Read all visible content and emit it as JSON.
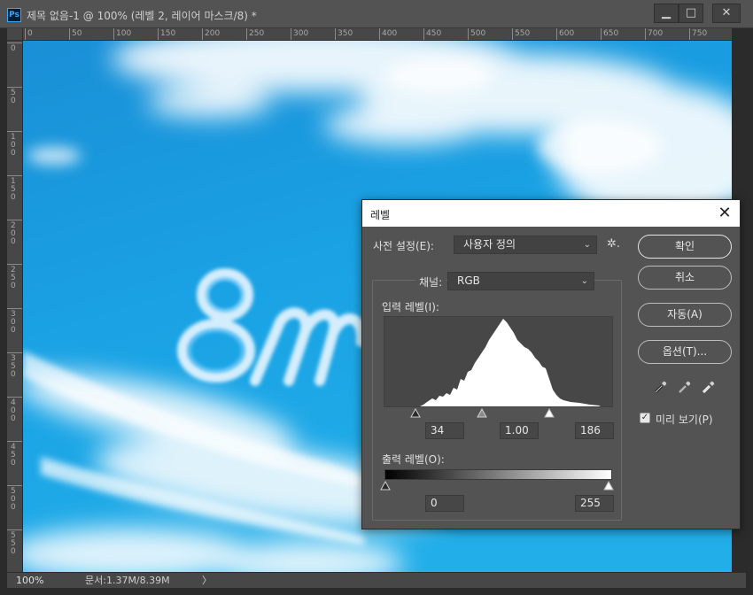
{
  "window": {
    "app_badge": "Ps",
    "title": "제목 없음-1 @ 100% (레벨 2, 레이어 마스크/8) *",
    "minimize": "▁",
    "restore": "□",
    "close": "✕"
  },
  "ruler_h_labels": [
    "0",
    "50",
    "100",
    "150",
    "200",
    "250",
    "300",
    "350",
    "400",
    "450",
    "500",
    "550",
    "600",
    "650",
    "700",
    "750"
  ],
  "ruler_v_labels": [
    "0",
    "50",
    "100",
    "150",
    "200",
    "250",
    "300",
    "350",
    "400",
    "450",
    "500",
    "550"
  ],
  "canvas_text": "8m",
  "status": {
    "zoom": "100%",
    "doc_info": "문서:1.37M/8.39M",
    "arrow": "〉"
  },
  "dialog": {
    "title": "레벨",
    "close": "✕",
    "preset_label": "사전 설정(E):",
    "preset_value": "사용자 정의",
    "gear": "✲.",
    "channel_label": "채널:",
    "channel_value": "RGB",
    "input_levels_label": "입력 레벨(I):",
    "input_black": "34",
    "input_gamma": "1.00",
    "input_white": "186",
    "output_levels_label": "출력 레벨(O):",
    "output_black": "0",
    "output_white": "255",
    "ok": "확인",
    "cancel": "취소",
    "auto": "자동(A)",
    "options": "옵션(T)...",
    "preview_label": "미리 보기(P)",
    "preview_checked": true,
    "checkmark": "✓",
    "caret": "⌄"
  }
}
